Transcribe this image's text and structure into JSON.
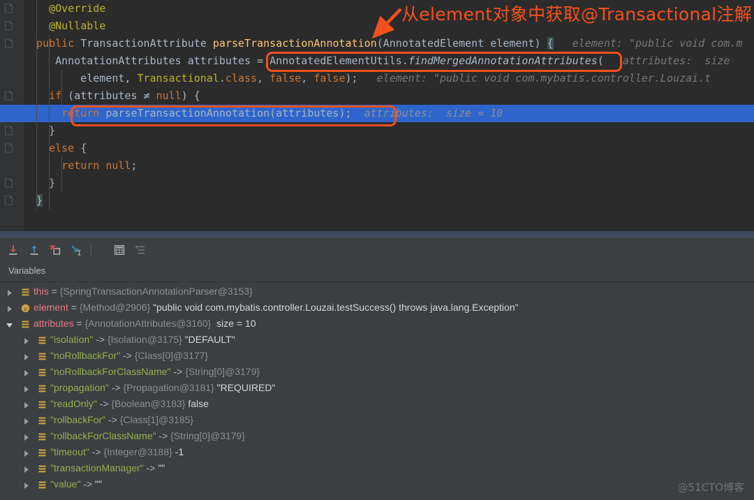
{
  "editor": {
    "lines": [
      {
        "indent": 4,
        "segments": [
          {
            "t": "@Override",
            "c": "an"
          }
        ]
      },
      {
        "indent": 4,
        "segments": [
          {
            "t": "@Nullable",
            "c": "an"
          }
        ]
      },
      {
        "indent": 2,
        "segments": [
          {
            "t": "public ",
            "c": "k"
          },
          {
            "t": "TransactionAttribute ",
            "c": "t"
          },
          {
            "t": "parseTransactionAnnotation",
            "c": "m"
          },
          {
            "t": "(AnnotatedElement element) ",
            "c": "t"
          },
          {
            "t": "{",
            "c": "brace-hl"
          },
          {
            "t": "   element: \"public void com.m",
            "c": "hint"
          }
        ]
      },
      {
        "indent": 5,
        "segments": [
          {
            "t": "AnnotationAttributes attributes = AnnotatedElementUtils.",
            "c": "t"
          },
          {
            "t": "findMergedAnnotationAttributes",
            "c": "t-ital"
          },
          {
            "t": "(",
            "c": "t"
          },
          {
            "t": "   attributes:  size",
            "c": "hint"
          }
        ]
      },
      {
        "indent": 9,
        "segments": [
          {
            "t": "element, ",
            "c": "t"
          },
          {
            "t": "Transactional",
            "c": "an"
          },
          {
            "t": ".",
            "c": "t"
          },
          {
            "t": "class",
            "c": "k"
          },
          {
            "t": ", ",
            "c": "t"
          },
          {
            "t": "false",
            "c": "k"
          },
          {
            "t": ", ",
            "c": "t"
          },
          {
            "t": "false",
            "c": "k"
          },
          {
            "t": ");",
            "c": "t"
          },
          {
            "t": "   element: \"public void com.mybatis.controller.Louzai.t",
            "c": "hint"
          }
        ]
      },
      {
        "indent": 4,
        "segments": [
          {
            "t": "if ",
            "c": "k"
          },
          {
            "t": "(attributes ",
            "c": "t"
          },
          {
            "t": "≠",
            "c": "t"
          },
          {
            "t": " ",
            "c": "t"
          },
          {
            "t": "null",
            "c": "k"
          },
          {
            "t": ") {",
            "c": "t"
          }
        ]
      },
      {
        "indent": 6,
        "highlight": true,
        "segments": [
          {
            "t": "return ",
            "c": "k"
          },
          {
            "t": "parseTransactionAnnotation(attributes);",
            "c": "t"
          },
          {
            "t": "  attributes:  size = 10",
            "c": "hintb"
          }
        ]
      },
      {
        "indent": 4,
        "segments": [
          {
            "t": "}",
            "c": "t"
          }
        ]
      },
      {
        "indent": 4,
        "segments": [
          {
            "t": "else ",
            "c": "k"
          },
          {
            "t": "{",
            "c": "t"
          }
        ]
      },
      {
        "indent": 6,
        "segments": [
          {
            "t": "return ",
            "c": "k"
          },
          {
            "t": "null",
            "c": "k"
          },
          {
            "t": ";",
            "c": "t"
          }
        ]
      },
      {
        "indent": 4,
        "segments": [
          {
            "t": "}",
            "c": "t"
          }
        ]
      },
      {
        "indent": 2,
        "segments": [
          {
            "t": "}",
            "c": "brace-hl"
          }
        ]
      }
    ]
  },
  "annotations": {
    "callout_text": "从 element对象中获取@Transactional注解",
    "callout_text_exact": "从element对象中获取@Transactional注解",
    "color": "#f4511e"
  },
  "debug_toolbar": {
    "buttons": [
      {
        "name": "step-into-icon",
        "title": "Step Into"
      },
      {
        "name": "step-out-icon",
        "title": "Step Out"
      },
      {
        "name": "force-step-into-icon",
        "title": "Force Step Into"
      },
      {
        "name": "run-to-cursor-icon",
        "title": "Run to Cursor"
      },
      {
        "name": "evaluate-expression-icon",
        "title": "Evaluate Expression"
      },
      {
        "name": "settings-sort-icon",
        "title": "Settings"
      }
    ]
  },
  "variables_panel": {
    "title": "Variables",
    "rows": [
      {
        "depth": 0,
        "expandable": true,
        "expanded": false,
        "icon": "field-icon",
        "parts": [
          {
            "t": "this",
            "c": "vname"
          },
          {
            "t": " = ",
            "c": "veq"
          },
          {
            "t": "{SpringTransactionAnnotationParser@3153}",
            "c": "vtype"
          }
        ]
      },
      {
        "depth": 0,
        "expandable": true,
        "expanded": false,
        "icon": "parameter-icon",
        "parts": [
          {
            "t": "element",
            "c": "vname"
          },
          {
            "t": " = ",
            "c": "veq"
          },
          {
            "t": "{Method@2906}",
            "c": "vtype"
          },
          {
            "t": " \"public void com.mybatis.controller.Louzai.testSuccess() throws java.lang.Exception\"",
            "c": "vval"
          }
        ]
      },
      {
        "depth": 0,
        "expandable": true,
        "expanded": true,
        "icon": "field-icon",
        "parts": [
          {
            "t": "attributes",
            "c": "vname"
          },
          {
            "t": " = ",
            "c": "veq"
          },
          {
            "t": "{AnnotationAttributes@3160}",
            "c": "vtype"
          },
          {
            "t": "  size = 10",
            "c": "vval"
          }
        ]
      },
      {
        "depth": 1,
        "expandable": true,
        "expanded": false,
        "icon": "field-icon",
        "parts": [
          {
            "t": "\"isolation\"",
            "c": "vkey"
          },
          {
            "t": " -> ",
            "c": "veq"
          },
          {
            "t": "{Isolation@3175}",
            "c": "vtype"
          },
          {
            "t": " \"DEFAULT\"",
            "c": "vval"
          }
        ]
      },
      {
        "depth": 1,
        "expandable": true,
        "expanded": false,
        "icon": "field-icon",
        "parts": [
          {
            "t": "\"noRollbackFor\"",
            "c": "vkey"
          },
          {
            "t": " -> ",
            "c": "veq"
          },
          {
            "t": "{Class[0]@3177}",
            "c": "vtype"
          }
        ]
      },
      {
        "depth": 1,
        "expandable": true,
        "expanded": false,
        "icon": "field-icon",
        "parts": [
          {
            "t": "\"noRollbackForClassName\"",
            "c": "vkey"
          },
          {
            "t": " -> ",
            "c": "veq"
          },
          {
            "t": "{String[0]@3179}",
            "c": "vtype"
          }
        ]
      },
      {
        "depth": 1,
        "expandable": true,
        "expanded": false,
        "icon": "field-icon",
        "parts": [
          {
            "t": "\"propagation\"",
            "c": "vkey"
          },
          {
            "t": " -> ",
            "c": "veq"
          },
          {
            "t": "{Propagation@3181}",
            "c": "vtype"
          },
          {
            "t": " \"REQUIRED\"",
            "c": "vval"
          }
        ]
      },
      {
        "depth": 1,
        "expandable": true,
        "expanded": false,
        "icon": "field-icon",
        "parts": [
          {
            "t": "\"readOnly\"",
            "c": "vkey"
          },
          {
            "t": " -> ",
            "c": "veq"
          },
          {
            "t": "{Boolean@3183}",
            "c": "vtype"
          },
          {
            "t": " false",
            "c": "vval"
          }
        ]
      },
      {
        "depth": 1,
        "expandable": true,
        "expanded": false,
        "icon": "field-icon",
        "parts": [
          {
            "t": "\"rollbackFor\"",
            "c": "vkey"
          },
          {
            "t": " -> ",
            "c": "veq"
          },
          {
            "t": "{Class[1]@3185}",
            "c": "vtype"
          }
        ]
      },
      {
        "depth": 1,
        "expandable": true,
        "expanded": false,
        "icon": "field-icon",
        "parts": [
          {
            "t": "\"rollbackForClassName\"",
            "c": "vkey"
          },
          {
            "t": " -> ",
            "c": "veq"
          },
          {
            "t": "{String[0]@3179}",
            "c": "vtype"
          }
        ]
      },
      {
        "depth": 1,
        "expandable": true,
        "expanded": false,
        "icon": "field-icon",
        "parts": [
          {
            "t": "\"timeout\"",
            "c": "vkey"
          },
          {
            "t": " -> ",
            "c": "veq"
          },
          {
            "t": "{Integer@3188}",
            "c": "vtype"
          },
          {
            "t": " -1",
            "c": "vval"
          }
        ]
      },
      {
        "depth": 1,
        "expandable": true,
        "expanded": false,
        "icon": "field-icon",
        "parts": [
          {
            "t": "\"transactionManager\"",
            "c": "vkey"
          },
          {
            "t": " -> ",
            "c": "veq"
          },
          {
            "t": "\"\"",
            "c": "vval"
          }
        ]
      },
      {
        "depth": 1,
        "expandable": true,
        "expanded": false,
        "icon": "field-icon",
        "parts": [
          {
            "t": "\"value\"",
            "c": "vkey"
          },
          {
            "t": " -> ",
            "c": "veq"
          },
          {
            "t": "\"\"",
            "c": "vval"
          }
        ]
      }
    ]
  },
  "watermark": {
    "text": "@51CTO博客"
  },
  "colors": {
    "editor_bg": "#2b2b2b",
    "gutter_bg": "#313335",
    "panel_bg": "#3c3f41",
    "highlight_row": "#2f65ca",
    "annotation": "#f4511e",
    "keyword": "#cc7832",
    "annotation_token": "#bbb529",
    "method": "#ffc66d",
    "text": "#a9b7c6",
    "var_name": "#e8788a",
    "var_key": "#8fb14f",
    "var_type": "#8a8f94"
  }
}
